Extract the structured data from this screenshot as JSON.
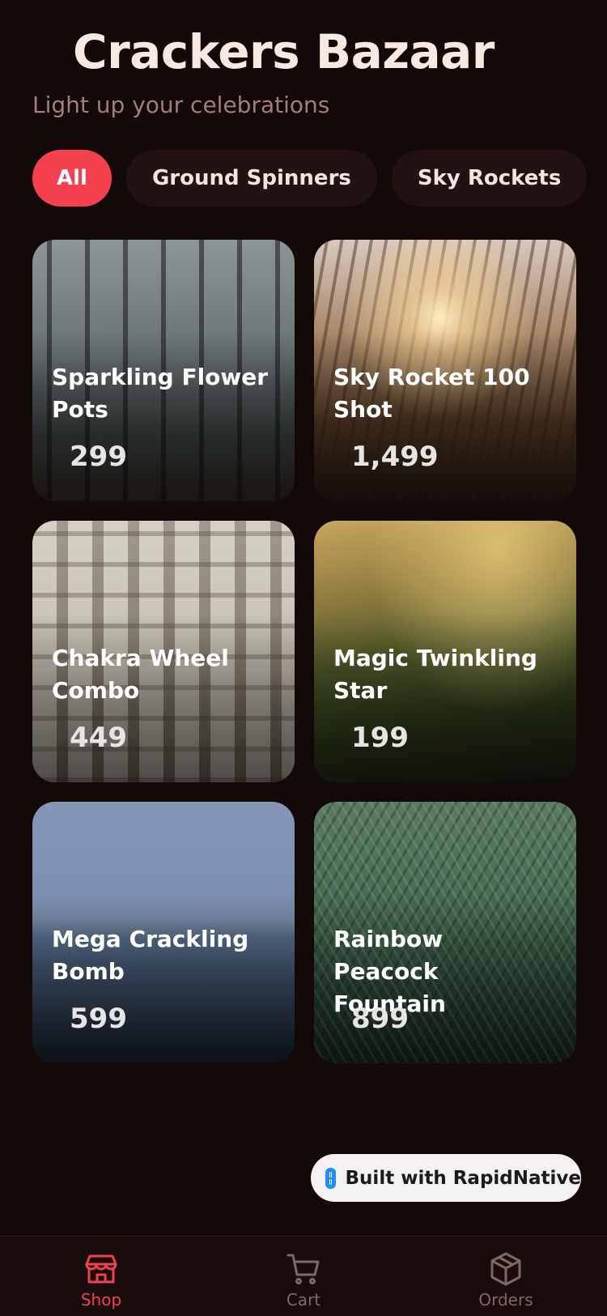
{
  "header": {
    "title": "Crackers Bazaar",
    "subtitle": "Light up your celebrations"
  },
  "categories": [
    {
      "label": "All",
      "active": true
    },
    {
      "label": "Ground Spinners",
      "active": false
    },
    {
      "label": "Sky Rockets",
      "active": false
    }
  ],
  "products": [
    {
      "name": "Sparkling Flower Pots",
      "price": "299"
    },
    {
      "name": "Sky Rocket 100 Shot",
      "price": "1,499"
    },
    {
      "name": "Chakra Wheel Combo",
      "price": "449"
    },
    {
      "name": "Magic Twinkling Star",
      "price": "199"
    },
    {
      "name": "Mega Crackling Bomb",
      "price": "599"
    },
    {
      "name": "Rainbow Peacock Fountain",
      "price": "899"
    }
  ],
  "badge": {
    "label": "Built with RapidNative"
  },
  "nav": {
    "items": [
      {
        "label": "Shop",
        "icon": "store-icon",
        "active": true
      },
      {
        "label": "Cart",
        "icon": "cart-icon",
        "active": false
      },
      {
        "label": "Orders",
        "icon": "box-icon",
        "active": false
      }
    ]
  },
  "colors": {
    "background": "#130909",
    "accent": "#f4404f",
    "chip_inactive": "#221212",
    "subtitle": "#a07e79",
    "nav_inactive": "#7f6864"
  }
}
